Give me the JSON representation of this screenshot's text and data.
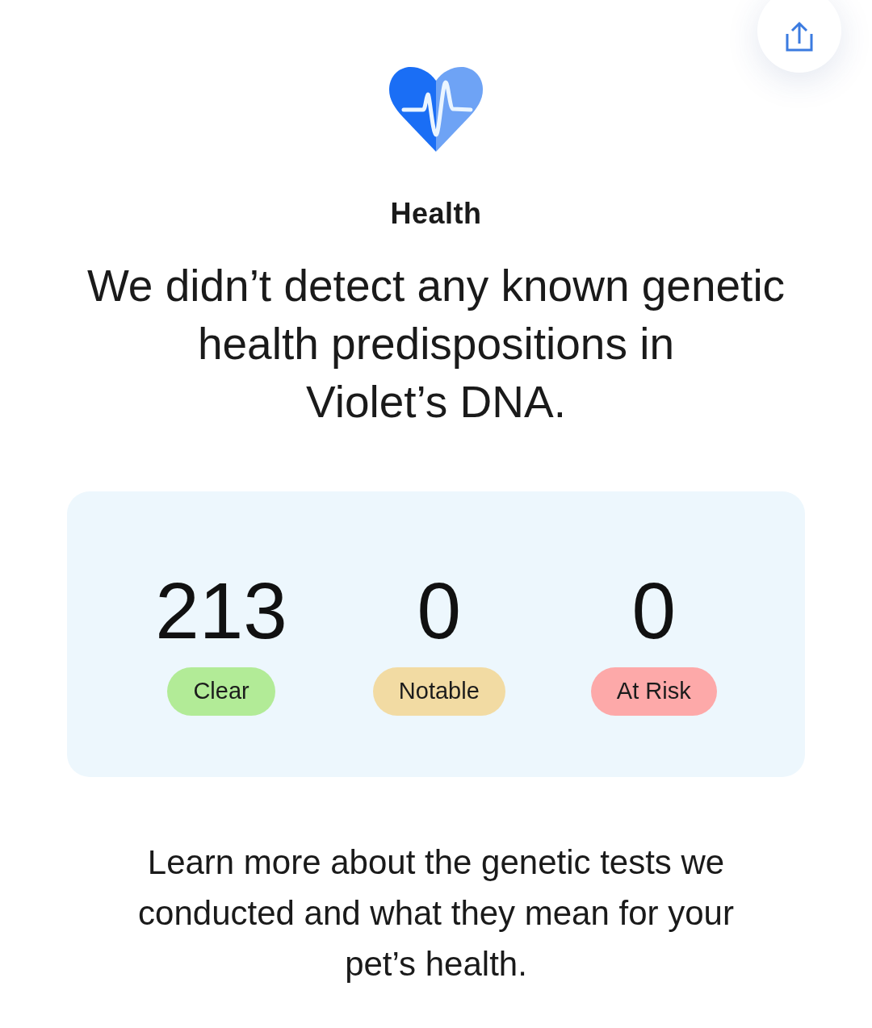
{
  "category": {
    "title": "Health"
  },
  "headline": "We didn’t detect any known genetic\nhealth predispositions in\nViolet’s DNA.",
  "summary": {
    "stats": [
      {
        "count": "213",
        "label": "Clear",
        "color": "#b2eb97"
      },
      {
        "count": "0",
        "label": "Notable",
        "color": "#f2dba3"
      },
      {
        "count": "0",
        "label": "At Risk",
        "color": "#fda9a9"
      }
    ]
  },
  "footer_text": "Learn more about the genetic tests we\nconducted and what they mean for your\npet’s health."
}
